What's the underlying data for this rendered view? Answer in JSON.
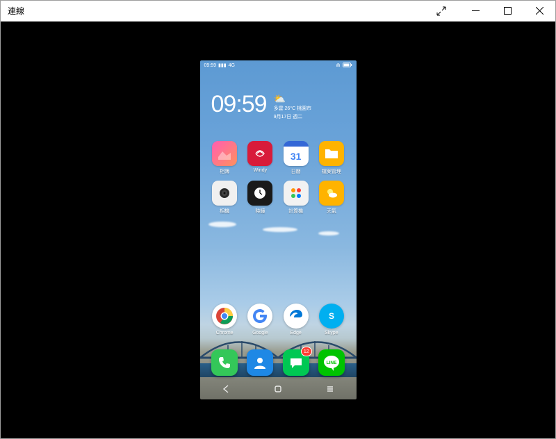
{
  "window": {
    "title": "連線"
  },
  "phone": {
    "status": {
      "time": "09:59",
      "signal": "4G"
    },
    "clock": {
      "time": "09:59",
      "weather_desc": "多雲 26°C 桃園市",
      "date": "9月17日 週二"
    },
    "apps_row1": [
      {
        "id": "photos",
        "label": "相簿"
      },
      {
        "id": "windy",
        "label": "Windy"
      },
      {
        "id": "calendar",
        "label": "日曆",
        "daynum": "31"
      },
      {
        "id": "files",
        "label": "檔案管理"
      }
    ],
    "apps_row2": [
      {
        "id": "camera",
        "label": "相機"
      },
      {
        "id": "clock",
        "label": "時鐘"
      },
      {
        "id": "calc",
        "label": "計算機"
      },
      {
        "id": "weather",
        "label": "天氣"
      }
    ],
    "fav": [
      {
        "id": "chrome",
        "label": "Chrome"
      },
      {
        "id": "google",
        "label": "Google"
      },
      {
        "id": "edge",
        "label": "Edge"
      },
      {
        "id": "skype",
        "label": "Skype"
      }
    ],
    "dock": [
      {
        "id": "phone",
        "label": "Phone"
      },
      {
        "id": "contacts",
        "label": "Contacts"
      },
      {
        "id": "messages",
        "label": "Messages",
        "badge": "12"
      },
      {
        "id": "line",
        "label": "LINE",
        "text": "LINE"
      }
    ],
    "nav": [
      "back",
      "home",
      "recent"
    ]
  }
}
